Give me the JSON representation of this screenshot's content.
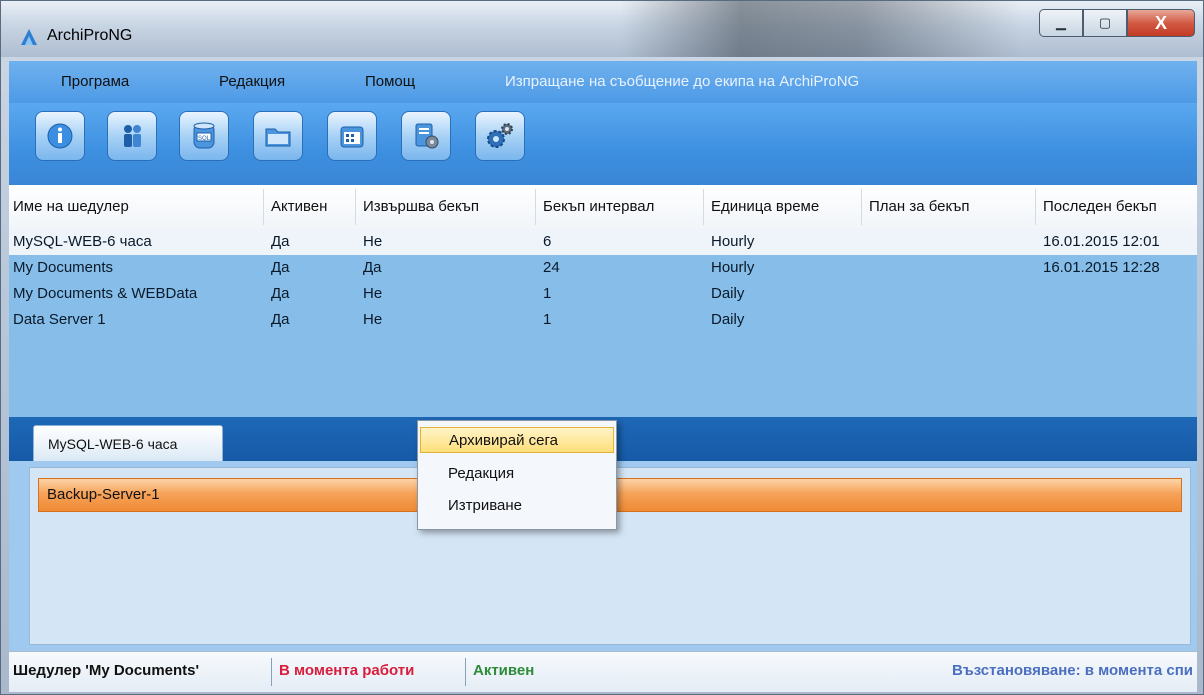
{
  "window": {
    "title": "ArchiProNG",
    "minimize_glyph": "▁",
    "maximize_glyph": "▢",
    "close_glyph": "X"
  },
  "menu": {
    "items": [
      "Програма",
      "Редакция",
      "Помощ"
    ],
    "link": "Изпращане на съобщение до екипа на ArchiProNG"
  },
  "toolbar": {
    "icons": [
      "info-icon",
      "users-icon",
      "sql-database-icon",
      "folder-icon",
      "calendar-icon",
      "server-settings-icon",
      "gears-icon"
    ]
  },
  "grid": {
    "columns": [
      "Име на шедулер",
      "Активен",
      "Извършва бекъп",
      "Бекъп интервал",
      "Единица време",
      "План за бекъп",
      "Последен бекъп"
    ],
    "rows": [
      {
        "name": "MySQL-WEB-6 часа",
        "active": "Да",
        "running": "Не",
        "interval": "6",
        "unit": "Hourly",
        "plan": "",
        "last": "16.01.2015 12:01"
      },
      {
        "name": "My Documents",
        "active": "Да",
        "running": "Да",
        "interval": "24",
        "unit": "Hourly",
        "plan": "",
        "last": "16.01.2015 12:28"
      },
      {
        "name": "My Documents & WEBData",
        "active": "Да",
        "running": "Не",
        "interval": "1",
        "unit": "Daily",
        "plan": "",
        "last": ""
      },
      {
        "name": "Data Server 1",
        "active": "Да",
        "running": "Не",
        "interval": "1",
        "unit": "Daily",
        "plan": "",
        "last": ""
      }
    ]
  },
  "tab": {
    "label": "MySQL-WEB-6 часа",
    "item": "Backup-Server-1"
  },
  "context_menu": {
    "items": [
      "Архивирай сега",
      "Редакция",
      "Изтриване"
    ]
  },
  "status": {
    "scheduler": "Шедулер 'My Documents'",
    "working": "В момента работи",
    "active": "Активен",
    "restore": "Възстановяване: в момента спи"
  },
  "colors": {
    "working": "#d81e3c",
    "active": "#2e8b3a",
    "restore": "#4a6fc0"
  }
}
